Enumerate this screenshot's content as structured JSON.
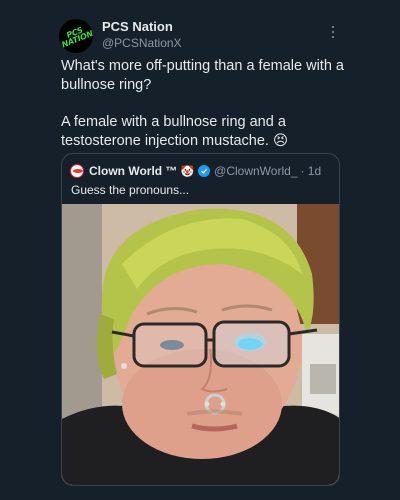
{
  "post": {
    "author": {
      "display_name": "PCS Nation",
      "handle": "@PCSNationX",
      "avatar_text": "PCS NATION"
    },
    "more_icon": "more-horizontal-icon",
    "text_paragraphs": [
      "What's more off-putting than a female with a bullnose ring?",
      "A female with a bullnose ring and a testosterone injection mustache. 😣"
    ]
  },
  "quote": {
    "author": {
      "display_name": "Clown World ™",
      "clown_emoji": "🤡",
      "handle": "@ClownWorld_",
      "time": "· 1d"
    },
    "text": "Guess the pronouns...",
    "photo_icon": "photo-selfie-image"
  },
  "colors": {
    "background": "#15202b",
    "text": "#e7e9ea",
    "secondary_text": "#8b98a5",
    "border": "#38444d",
    "verified": "#1d9bf0",
    "logo_green": "#3ddc3d"
  }
}
